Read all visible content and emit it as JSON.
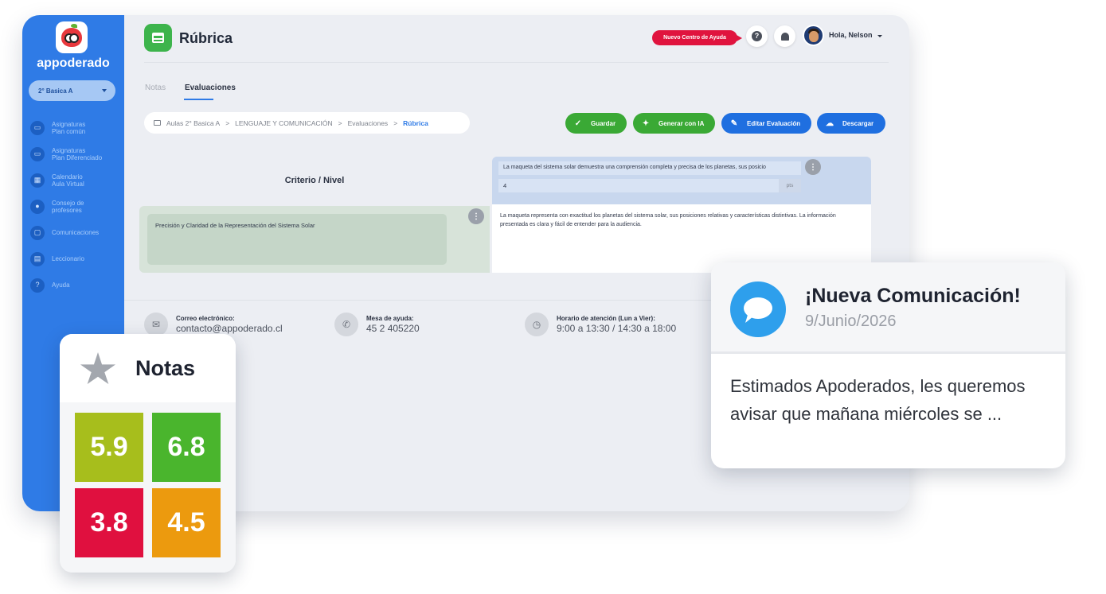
{
  "app": {
    "brand": "appoderado",
    "course": "2° Basica A",
    "page_title": "Rúbrica"
  },
  "sidebar": {
    "items": [
      {
        "label": "Asignaturas\nPlan común",
        "icon": "board-icon"
      },
      {
        "label": "Asignaturas\nPlan Diferenciado",
        "icon": "board-icon"
      },
      {
        "label": "Calendario\nAula Virtual",
        "icon": "calendar-icon"
      },
      {
        "label": "Consejo de\nprofesores",
        "icon": "people-icon"
      },
      {
        "label": "Comunicaciones",
        "icon": "chat-icon"
      },
      {
        "label": "Leccionario",
        "icon": "document-icon"
      },
      {
        "label": "Ayuda",
        "icon": "question-icon"
      }
    ]
  },
  "header": {
    "help_center": "Nuevo Centro de Ayuda",
    "user_greeting": "Hola, Nelson"
  },
  "tabs": {
    "notas": "Notas",
    "evaluaciones": "Evaluaciones"
  },
  "breadcrumb": {
    "items": [
      "Aulas 2° Basica A",
      "LENGUAJE Y COMUNICACIÓN",
      "Evaluaciones",
      "Rúbrica"
    ],
    "separator": ">"
  },
  "actions": {
    "guardar": "Guardar",
    "generar": "Generar con IA",
    "editar": "Editar Evaluación",
    "descargar": "Descargar"
  },
  "rubric": {
    "criteria_header": "Criterio / Nivel",
    "level_description": "La maqueta del sistema solar demuestra una comprensión completa y precisa de los planetas, sus posicio",
    "points": "4",
    "points_unit": "pts",
    "criterion": "Precisión y Claridad de la Representación del Sistema Solar",
    "cell_text": "La maqueta representa con exactitud los planetas del sistema solar, sus posiciones relativas y características distintivas. La información presentada es clara y fácil de entender para la audiencia."
  },
  "footer": {
    "email_label": "Correo electrónico:",
    "email": "contacto@appoderado.cl",
    "helpdesk_label": "Mesa de ayuda:",
    "helpdesk": "45 2 405220",
    "hours_label": "Horario de atención (Lun a Vier):",
    "hours": "9:00 a 13:30 / 14:30 a 18:00"
  },
  "notas_card": {
    "title": "Notas",
    "grades": [
      {
        "value": "5.9",
        "color": "#a7be1c"
      },
      {
        "value": "6.8",
        "color": "#4ab52d"
      },
      {
        "value": "3.8",
        "color": "#e0103f"
      },
      {
        "value": "4.5",
        "color": "#ec9a0e"
      }
    ]
  },
  "message_card": {
    "title": "¡Nueva Comunicación!",
    "date": "9/Junio/2026",
    "body": "Estimados Apoderados, les queremos avisar que mañana miércoles se ..."
  },
  "colors": {
    "sidebar": "#2f7be6",
    "accent_green": "#3aa935",
    "accent_blue": "#1f6fe0",
    "help_red": "#e0133e"
  }
}
